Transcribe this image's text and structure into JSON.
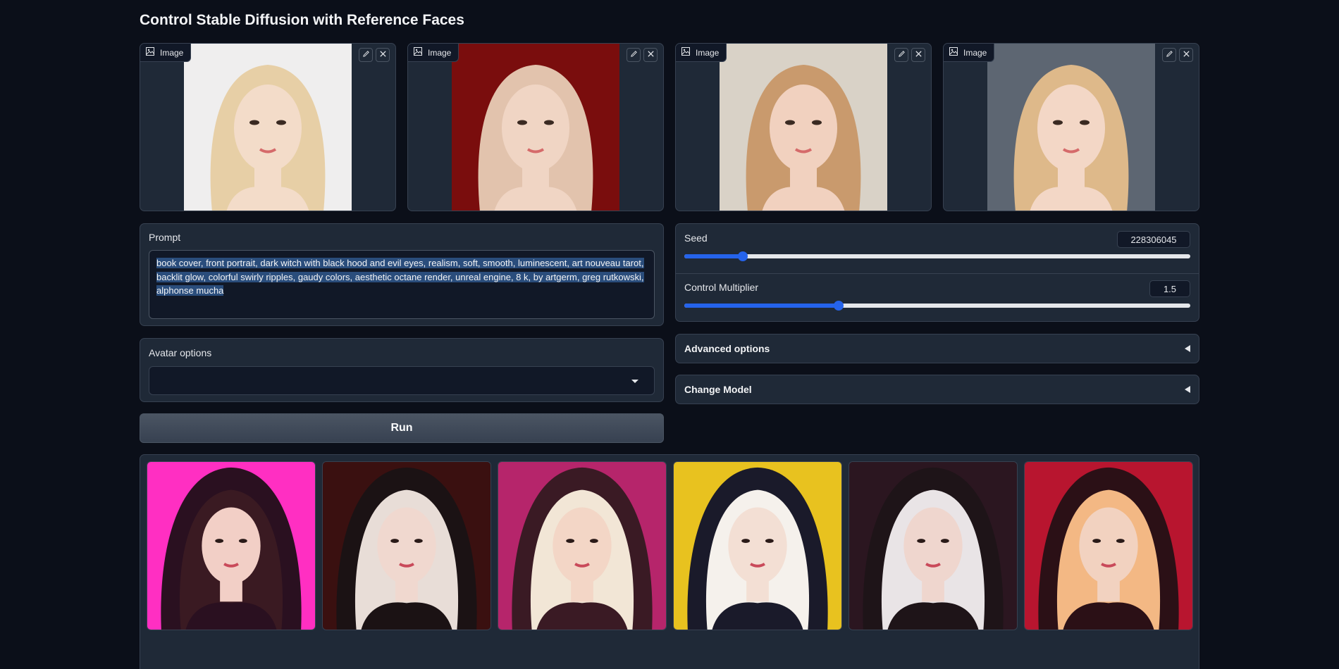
{
  "page": {
    "title": "Control Stable Diffusion with Reference Faces"
  },
  "reference_images": [
    {
      "label": "Image",
      "bg": "#efeeee",
      "hair": "#e7cfa6",
      "skin": "#f3dcc9"
    },
    {
      "label": "Image",
      "bg": "#7a0d0d",
      "hair": "#e2c3ad",
      "skin": "#f0d5c4"
    },
    {
      "label": "Image",
      "bg": "#d9d2c7",
      "hair": "#c99a6d",
      "skin": "#f1d1bf"
    },
    {
      "label": "Image",
      "bg": "#5d6672",
      "hair": "#deb98a",
      "skin": "#f3d7c6"
    }
  ],
  "prompt": {
    "label": "Prompt",
    "value": "book cover, front portrait, dark witch with black hood and evil eyes, realism, soft, smooth, luminescent, art nouveau tarot, backlit glow, colorful swirly ripples, gaudy colors, aesthetic octane render, unreal engine, 8 k, by artgerm, greg rutkowski, alphonse mucha"
  },
  "avatar_options": {
    "label": "Avatar options",
    "value": ""
  },
  "run_button": {
    "label": "Run"
  },
  "seed": {
    "label": "Seed",
    "value": "228306045",
    "fill_fraction": 0.115
  },
  "control_multiplier": {
    "label": "Control Multiplier",
    "value": "1.5",
    "fill_fraction": 0.305
  },
  "advanced_options": {
    "label": "Advanced options"
  },
  "change_model": {
    "label": "Change Model"
  },
  "gallery": [
    {
      "bg": "#ff2fc2",
      "hood": "#2a1020",
      "hair": "#3a1a22",
      "skin": "#f2cfc6"
    },
    {
      "bg": "#3a1010",
      "hood": "#1b1214",
      "hair": "#e8ddd7",
      "skin": "#f0d8cf"
    },
    {
      "bg": "#b6256b",
      "hood": "#3a1a24",
      "hair": "#f2e6d6",
      "skin": "#f3d6c6"
    },
    {
      "bg": "#e8c21f",
      "hood": "#1a1a2a",
      "hair": "#f5f1ec",
      "skin": "#f3dfd4"
    },
    {
      "bg": "#2b1620",
      "hood": "#1e1418",
      "hair": "#e9e4e6",
      "skin": "#efd6ce"
    },
    {
      "bg": "#b8152f",
      "hood": "#2b1016",
      "hair": "#f3b884",
      "skin": "#f2d2c0"
    }
  ]
}
